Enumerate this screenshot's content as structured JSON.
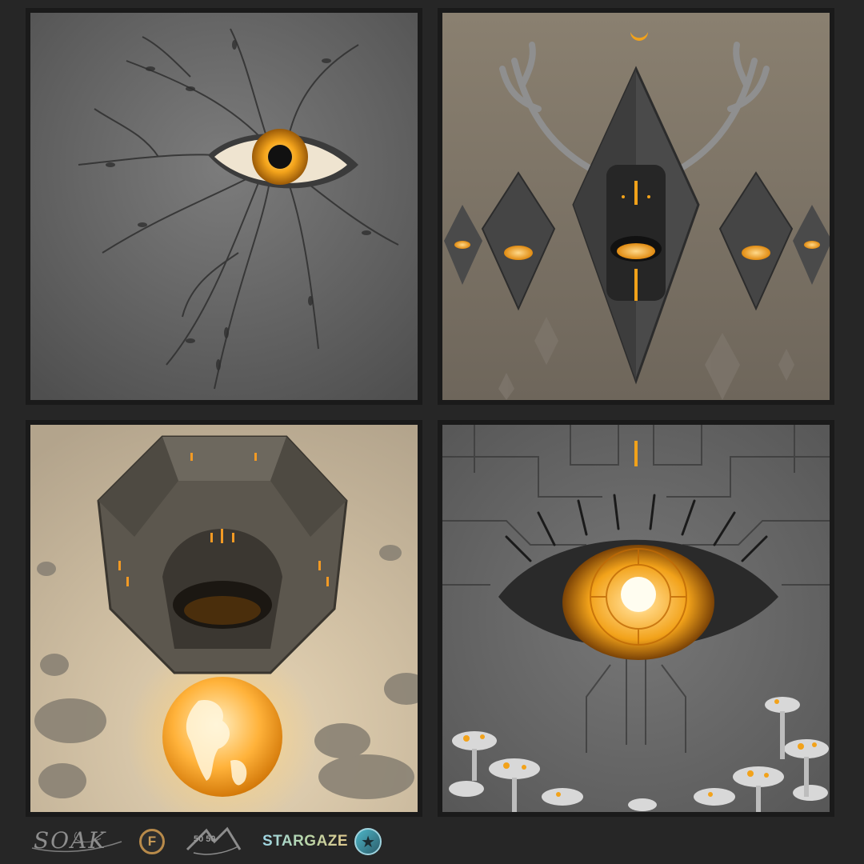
{
  "artworks": [
    {
      "subject": "eye with branching vines"
    },
    {
      "subject": "crystal totems with antlers and glowing eyes"
    },
    {
      "subject": "dodecahedron eye over glowing globe"
    },
    {
      "subject": "circuit eye above mushroom field"
    }
  ],
  "footer": {
    "signature": "SOAK",
    "f_badge": "F",
    "fifty_mark": "50 50",
    "stargaze": "STARGAZE",
    "star_icon": "star-icon"
  },
  "colors": {
    "background": "#262626",
    "accent": "#f2a21a",
    "panel_gray": "#6b6b6b"
  }
}
